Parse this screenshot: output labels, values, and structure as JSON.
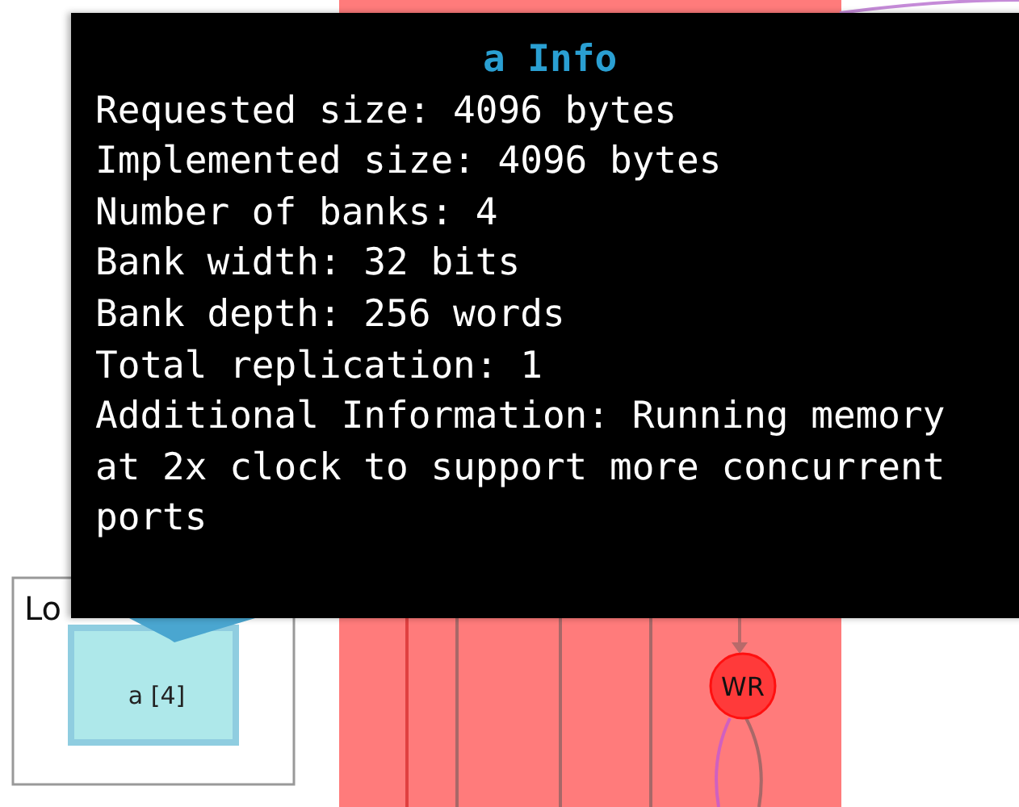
{
  "tooltip": {
    "title": "a Info",
    "lines": [
      "Requested size: 4096 bytes",
      "Implemented size: 4096 bytes",
      "Number of banks: 4",
      "Bank width: 32 bits",
      "Bank depth: 256 words",
      "Total replication: 1",
      "Additional Information: Running memory at 2x clock to support more concurrent ports"
    ]
  },
  "memory_box": {
    "title": "Lo",
    "node": "a [4]"
  },
  "port_node": {
    "label": "WR"
  }
}
